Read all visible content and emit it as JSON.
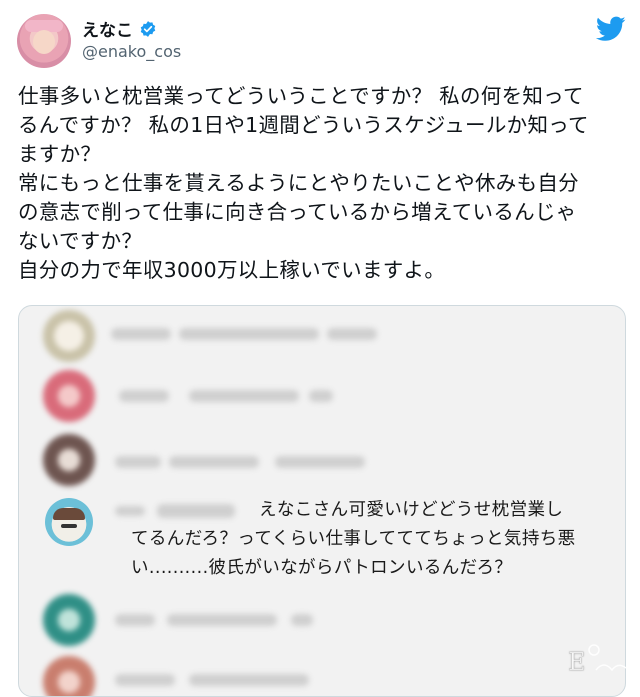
{
  "user": {
    "display_name": "えなこ",
    "handle": "@enako_cos"
  },
  "icons": {
    "verified": "verified-badge-icon",
    "brand": "twitter-bird-icon"
  },
  "colors": {
    "brand_blue": "#1d9bf0",
    "text": "#0f1419",
    "muted": "#536471"
  },
  "tweet": {
    "lines": [
      "仕事多いと枕営業ってどういうことですか？ 私の何を知って",
      "るんですか？ 私の1日や1週間どういうスケジュールか知って",
      "ますか？",
      "常にもっと仕事を貰えるようにとやりたいことや休みも自分",
      "の意志で削って仕事に向き合っているから増えているんじゃ",
      "ないですか？",
      "自分の力で年収3000万以上稼いでいますよ。"
    ]
  },
  "embed": {
    "highlighted_comment": {
      "lines": [
        "えなこさん可愛いけどどうせ枕営業し",
        "てるんだろ？ってくらい仕事してててちょっと気持ち悪",
        "い..........彼氏がいながらパトロンいるんだろ？"
      ]
    }
  }
}
